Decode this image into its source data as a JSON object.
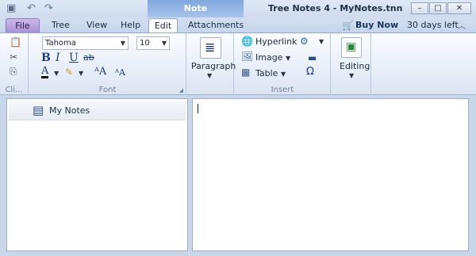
{
  "window": {
    "title": "Tree Notes 4 - MyNotes.tnn",
    "context_tab": "Note",
    "buy_now": "Buy Now",
    "trial": "30 days left"
  },
  "tabs": [
    "File",
    "Tree",
    "View",
    "Help",
    "Edit",
    "Attachments"
  ],
  "ribbon": {
    "clipboard_label": "Cli...",
    "font_label": "Font",
    "font_name": "Tahoma",
    "font_size": "10",
    "paragraph_label": "Paragraph",
    "insert_label": "Insert",
    "hyperlink": "Hyperlink",
    "image": "Image",
    "table": "Table",
    "editing": "Editing"
  },
  "tree": {
    "items": [
      {
        "label": "My Notes"
      }
    ]
  },
  "colors": {
    "accent": "#7fa6de",
    "file_tab": "#a992d4",
    "ribbon_bg": "#e4ecf7"
  }
}
